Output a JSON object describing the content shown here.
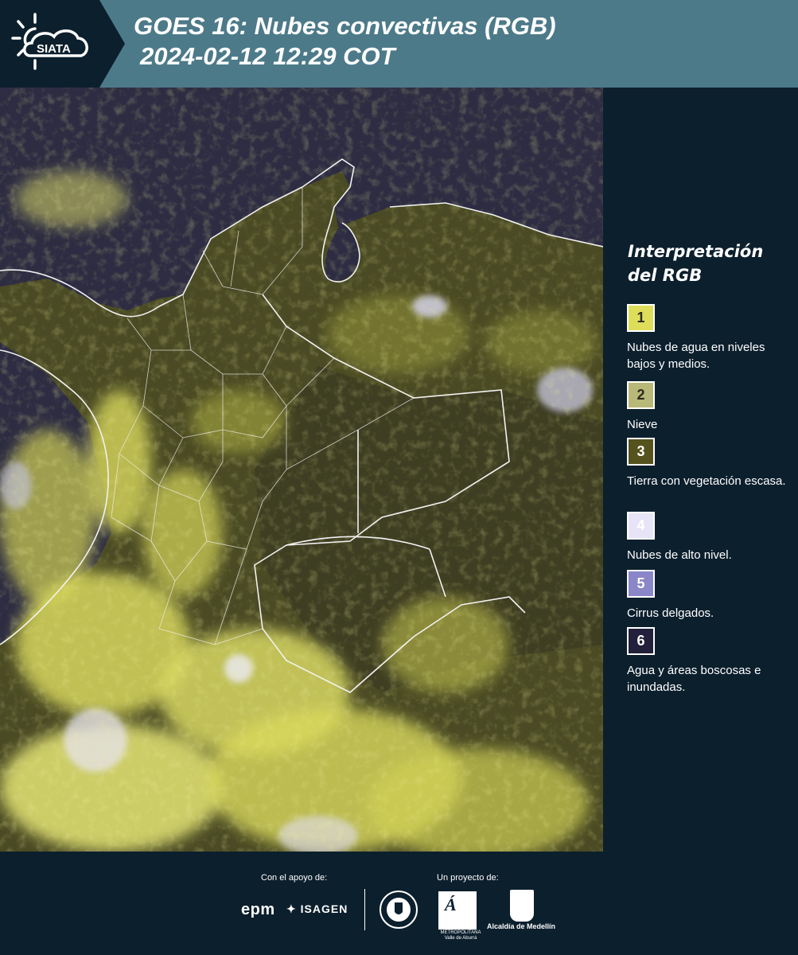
{
  "header": {
    "logo_text": "SIATA",
    "title_line1": "GOES 16: Nubes convectivas (RGB)",
    "title_line2": "2024-02-12 12:29 COT",
    "background_color": "#4d7a89"
  },
  "legend": {
    "title_line1": "Interpretación",
    "title_line2": "del RGB",
    "items": [
      {
        "number": "1",
        "label": "Nubes de agua en niveles bajos y medios.",
        "color": "#dede5a"
      },
      {
        "number": "2",
        "label": "Nieve",
        "color": "#b8b878"
      },
      {
        "number": "3",
        "label": "Tierra con vegetación escasa.",
        "color": "#55521e"
      },
      {
        "number": "4",
        "label": "Nubes de alto nivel.",
        "color": "#e6e4f6"
      },
      {
        "number": "5",
        "label": "Cirrus delgados.",
        "color": "#8a86c8"
      },
      {
        "number": "6",
        "label": "Agua y áreas boscosas e inundadas.",
        "color": "#22203a"
      }
    ]
  },
  "footer": {
    "support_label": "Con el apoyo de:",
    "project_label": "Un proyecto de:",
    "sponsor_epm": "epm",
    "sponsor_isagen": "ISAGEN",
    "area_caption_line1": "METROPOLITANA",
    "area_caption_line2": "Valle de Aburrá",
    "alcaldia_label": "Alcaldía de Medellín"
  }
}
